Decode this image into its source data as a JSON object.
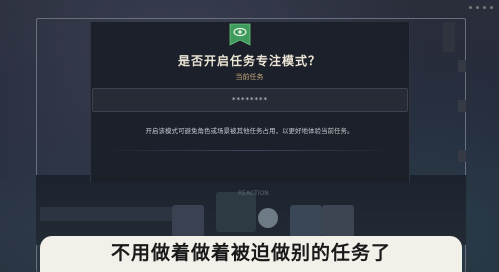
{
  "dialog": {
    "title": "是否开启任务专注模式？",
    "subtitle": "当前任务",
    "current_task_value": "********",
    "description": "开启该模式可避免角色或场景被其他任务占用，以更好地体验当前任务。",
    "badge_icon": "eye-badge-icon"
  },
  "background": {
    "top_left_text": "",
    "row_text": "",
    "panel_label": "REACTION"
  },
  "caption": {
    "text": "不用做着做着被迫做别的任务了"
  },
  "colors": {
    "title": "#ece5d6",
    "subtitle": "#c3a87a",
    "badge": "#4fae6a",
    "caption_bg": "#f3f0ea"
  }
}
